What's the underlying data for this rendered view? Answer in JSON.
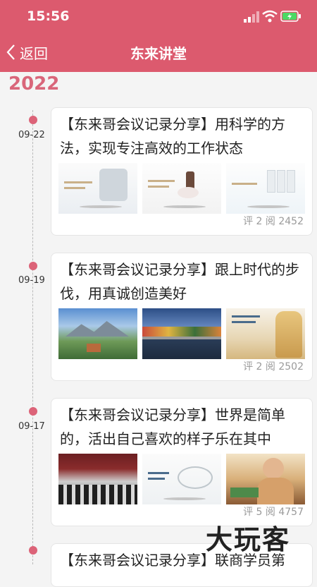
{
  "status": {
    "time": "15:56"
  },
  "nav": {
    "back_label": "返回",
    "title": "东来讲堂"
  },
  "timeline": {
    "year": "2022",
    "articles": [
      {
        "date": "09-22",
        "title": "【东来哥会议记录分享】用科学的方法，实现专注高效的工作状态",
        "meta": "评 2 阅 2452"
      },
      {
        "date": "09-19",
        "title": "【东来哥会议记录分享】跟上时代的步伐，用真诚创造美好",
        "meta": "评 2 阅 2502"
      },
      {
        "date": "09-17",
        "title": "【东来哥会议记录分享】世界是简单的，活出自己喜欢的样子乐在其中",
        "meta": "评 5 阅 4757"
      },
      {
        "title": "【东来哥会议记录分享】联商学员第"
      }
    ]
  },
  "watermark": "大玩客",
  "colors": {
    "header": "#dc5a6e",
    "accent": "#d9667a",
    "dot": "#dc6378"
  }
}
